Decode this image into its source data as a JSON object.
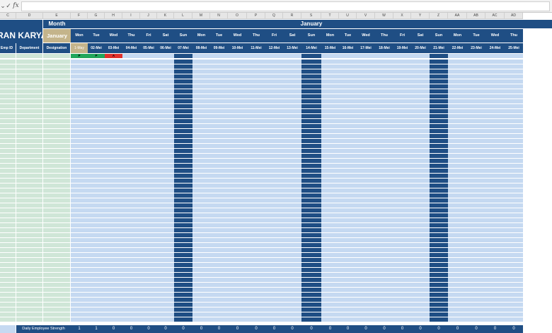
{
  "formula_bar": {
    "dropdown_glyph": "⌄",
    "cancel_glyph": "✓",
    "fx_label": "fx",
    "content": ""
  },
  "column_letters": [
    "C",
    "D",
    "E",
    "F",
    "G",
    "H",
    "I",
    "J",
    "K",
    "L",
    "M",
    "N",
    "O",
    "P",
    "Q",
    "R",
    "S",
    "T",
    "U",
    "V",
    "W",
    "X",
    "Y",
    "Z",
    "AA",
    "AB",
    "AC",
    "AD"
  ],
  "sheet": {
    "title_partial": "RAN KARYA",
    "month_label": "Month",
    "month_value": "January",
    "month_banner": "January",
    "headers": {
      "emp_id": "Emp ID",
      "department": "Department",
      "designation": "Designation"
    },
    "weekdays": [
      "Mon",
      "Tue",
      "Wed",
      "Thu",
      "Fri",
      "Sat",
      "Sun",
      "Mon",
      "Tue",
      "Wed",
      "Thu",
      "Fri",
      "Sat",
      "Sun",
      "Mon",
      "Tue",
      "Wed",
      "Thu",
      "Fri",
      "Sat",
      "Sun",
      "Mon",
      "Tue",
      "Wed",
      "Thu"
    ],
    "dates": [
      "1-May",
      "02-Mei",
      "03-Mei",
      "04-Mei",
      "05-Mei",
      "06-Mei",
      "07-Mei",
      "08-Mei",
      "09-Mei",
      "10-Mei",
      "11-Mei",
      "12-Mei",
      "13-Mei",
      "14-Mei",
      "15-Mei",
      "16-Mei",
      "17-Mei",
      "18-Mei",
      "19-Mei",
      "20-Mei",
      "21-Mei",
      "22-Mei",
      "23-Mei",
      "24-Mei",
      "25-Mei"
    ],
    "attendance_row1": [
      {
        "mark": "P",
        "status": "present",
        "color": "#21a65b"
      },
      {
        "mark": "P",
        "status": "present",
        "color": "#21a65b"
      },
      {
        "mark": "A",
        "status": "absent",
        "color": "#e0302a"
      }
    ],
    "footer_label": "Daily Employee  Strength",
    "daily_strength": [
      1,
      1,
      0,
      0,
      0,
      0,
      0,
      0,
      0,
      0,
      0,
      0,
      0,
      0,
      0,
      0,
      0,
      0,
      0,
      0,
      0,
      0,
      0,
      0,
      0
    ]
  },
  "colors": {
    "navy": "#1f4e84",
    "light_blue": "#c5d9f1",
    "light_green": "#cfe6d7",
    "tan": "#c4b48b",
    "present": "#21a65b",
    "absent": "#e0302a"
  }
}
